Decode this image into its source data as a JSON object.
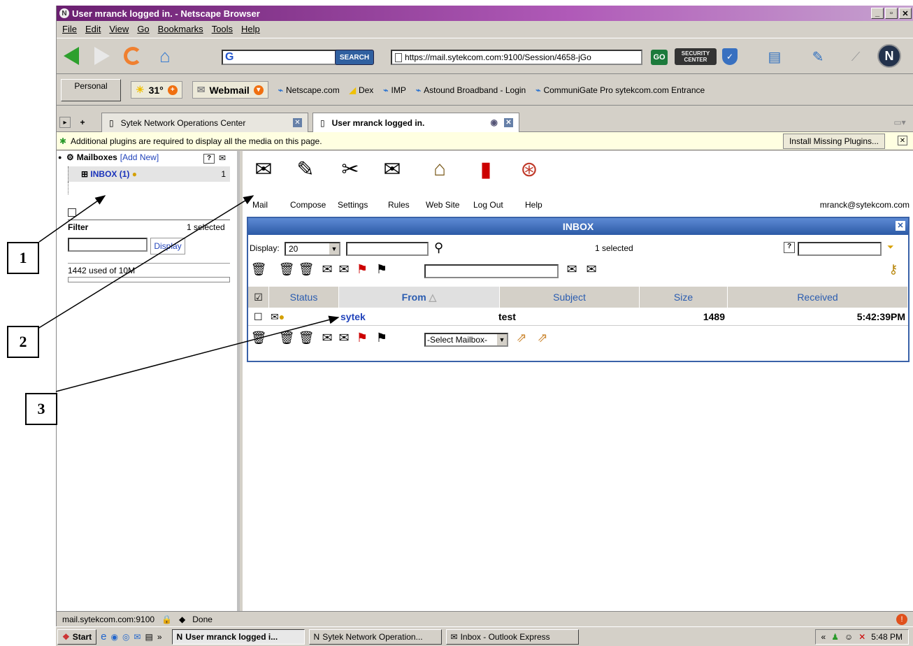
{
  "window": {
    "title": "User mranck logged in. - Netscape Browser"
  },
  "menu": [
    "File",
    "Edit",
    "View",
    "Go",
    "Bookmarks",
    "Tools",
    "Help"
  ],
  "nav": {
    "search_label": "SEARCH",
    "url": "https://mail.sytekcom.com:9100/Session/4658-jGo",
    "go": "GO",
    "security_center": "SECURITY CENTER"
  },
  "personal_bar": {
    "personal": "Personal",
    "weather": "31°",
    "webmail": "Webmail",
    "bookmarks": [
      "Netscape.com",
      "Dex",
      "IMP",
      "Astound Broadband - Login",
      "CommuniGate Pro sytekcom.com Entrance"
    ]
  },
  "tabs": [
    {
      "label": "Sytek Network Operations Center"
    },
    {
      "label": "User mranck logged in."
    }
  ],
  "plugin_bar": {
    "message": "Additional plugins are required to display all the media on this page.",
    "button": "Install Missing Plugins..."
  },
  "sidebar": {
    "mailboxes": "Mailboxes",
    "add_new": "[Add New]",
    "inbox": "INBOX (1)",
    "inbox_count": "1",
    "filter": "Filter",
    "selected": "1 selected",
    "display_btn": "Display",
    "usage": "1442 used of 10M"
  },
  "toolbar": {
    "labels": [
      "Mail",
      "Compose",
      "Settings",
      "Rules",
      "Web Site",
      "Log Out",
      "Help"
    ],
    "user": "mranck@sytekcom.com"
  },
  "inbox": {
    "title": "INBOX",
    "display_label": "Display:",
    "display_value": "20",
    "selected": "1 selected",
    "help": "?",
    "columns": [
      "Status",
      "From",
      "Subject",
      "Size",
      "Received"
    ],
    "rows": [
      {
        "from": "sytek",
        "subject": "test",
        "size": "1489",
        "received": "5:42:39PM"
      }
    ],
    "select_mailbox": "-Select Mailbox-"
  },
  "status": {
    "host": "mail.sytekcom.com:9100",
    "state": "Done"
  },
  "taskbar": {
    "start": "Start",
    "items": [
      "User mranck logged i...",
      "Sytek Network Operation...",
      "Inbox - Outlook Express"
    ],
    "clock": "5:48 PM"
  },
  "callouts": [
    "1",
    "2",
    "3"
  ]
}
